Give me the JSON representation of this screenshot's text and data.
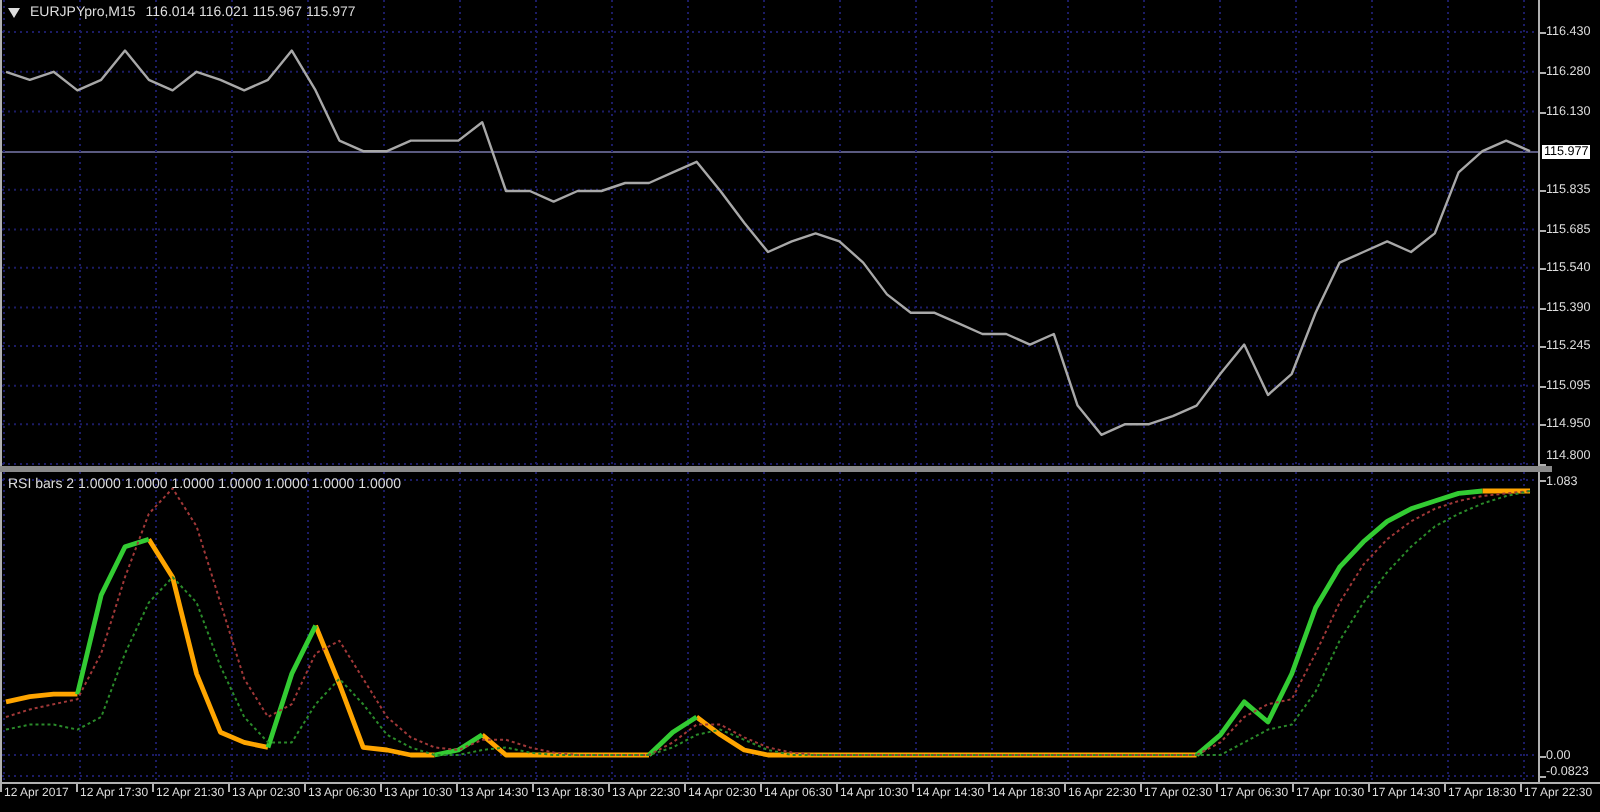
{
  "main_pane": {
    "title": "EURJPYpro,M15",
    "quote": "116.014 116.021 115.967 115.977",
    "chart_data": {
      "type": "line",
      "grid": true,
      "ylim": [
        114.792,
        116.551
      ],
      "ref_lines": [
        {
          "axis": "y",
          "value": 115.977,
          "label": "115.977"
        }
      ],
      "yticks": [
        {
          "value": 116.43,
          "label": "116.430"
        },
        {
          "value": 116.28,
          "label": "116.280"
        },
        {
          "value": 116.13,
          "label": "116.130"
        },
        {
          "value": 115.835,
          "label": "115.835"
        },
        {
          "value": 115.685,
          "label": "115.685"
        },
        {
          "value": 115.54,
          "label": "115.540"
        },
        {
          "value": 115.39,
          "label": "115.390"
        },
        {
          "value": 115.245,
          "label": "115.245"
        },
        {
          "value": 115.095,
          "label": "115.095"
        },
        {
          "value": 114.95,
          "label": "114.950"
        },
        {
          "value": 114.8,
          "label": "114.800"
        }
      ],
      "series": [
        {
          "color": "#a8a8a8",
          "values": [
            116.28,
            116.25,
            116.28,
            116.21,
            116.25,
            116.36,
            116.25,
            116.21,
            116.28,
            116.25,
            116.21,
            116.25,
            116.36,
            116.21,
            116.02,
            115.98,
            115.98,
            116.02,
            116.02,
            116.02,
            116.09,
            115.83,
            115.83,
            115.79,
            115.83,
            115.83,
            115.86,
            115.86,
            115.9,
            115.94,
            115.83,
            115.71,
            115.6,
            115.64,
            115.67,
            115.64,
            115.56,
            115.44,
            115.37,
            115.37,
            115.33,
            115.29,
            115.29,
            115.25,
            115.29,
            115.02,
            114.91,
            114.95,
            114.95,
            114.98,
            115.02,
            115.14,
            115.25,
            115.06,
            115.14,
            115.37,
            115.56,
            115.6,
            115.64,
            115.6,
            115.67,
            115.9,
            115.98,
            116.02,
            115.98
          ]
        }
      ]
    }
  },
  "indicator_pane": {
    "title": "RSI bars 2 1.0000 1.0000 1.0000 1.0000 1.0000 1.0000 1.0000",
    "chart_data": {
      "type": "line",
      "grid": true,
      "ylim": [
        -0.0823,
        1.083
      ],
      "yticks": [
        {
          "value": 1.083,
          "label": "1.083"
        },
        {
          "value": 0,
          "label": "0.00"
        },
        {
          "value": -0.0823,
          "label": "-0.0823"
        }
      ],
      "series": [
        {
          "color": "#ffa500",
          "line_style": "solid",
          "values": [
            0.21,
            0.23,
            0.24,
            0.24,
            null,
            null,
            0.85,
            0.7,
            0.32,
            0.09,
            0.05,
            0.03,
            null,
            0.51,
            0.28,
            0.03,
            0.02,
            0,
            0,
            null,
            0.08,
            0,
            0,
            0,
            0,
            0,
            0,
            0,
            null,
            0.15,
            0.08,
            0.02,
            0,
            0,
            0,
            0,
            0,
            0,
            0,
            0,
            0,
            0,
            0,
            0,
            0,
            0,
            0,
            0,
            0,
            0,
            0,
            null,
            null,
            null,
            null,
            null,
            null,
            null,
            null,
            null,
            null,
            null,
            1.04,
            1.04,
            1.04
          ]
        },
        {
          "color": "#33cc33",
          "line_style": "solid",
          "values": [
            null,
            null,
            null,
            0.24,
            0.63,
            0.82,
            0.85,
            null,
            null,
            null,
            null,
            0.03,
            0.32,
            0.51,
            null,
            null,
            null,
            null,
            0,
            0.02,
            0.08,
            null,
            null,
            null,
            null,
            null,
            null,
            0,
            0.09,
            0.15,
            null,
            null,
            null,
            null,
            null,
            null,
            null,
            null,
            null,
            null,
            null,
            null,
            null,
            null,
            null,
            null,
            null,
            null,
            null,
            null,
            0,
            0.08,
            0.21,
            0.13,
            0.32,
            0.58,
            0.74,
            0.84,
            0.92,
            0.97,
            1.0,
            1.03,
            1.04,
            null,
            null
          ]
        },
        {
          "color": "#a03838",
          "line_style": "dotted",
          "values": [
            0.15,
            0.18,
            0.2,
            0.22,
            0.4,
            0.7,
            0.95,
            1.05,
            0.9,
            0.6,
            0.3,
            0.15,
            0.2,
            0.4,
            0.45,
            0.3,
            0.15,
            0.07,
            0.03,
            0.02,
            0.06,
            0.06,
            0.03,
            0.01,
            0,
            0,
            0,
            0,
            0.05,
            0.12,
            0.12,
            0.07,
            0.03,
            0.01,
            0,
            0,
            0,
            0,
            0,
            0,
            0,
            0,
            0,
            0,
            0,
            0,
            0,
            0,
            0,
            0,
            0,
            0.05,
            0.15,
            0.2,
            0.22,
            0.4,
            0.6,
            0.75,
            0.85,
            0.92,
            0.97,
            1.0,
            1.02,
            1.03,
            1.04
          ]
        },
        {
          "color": "#2a8a2a",
          "line_style": "dotted",
          "values": [
            0.1,
            0.12,
            0.12,
            0.1,
            0.15,
            0.4,
            0.6,
            0.7,
            0.6,
            0.35,
            0.15,
            0.05,
            0.05,
            0.2,
            0.3,
            0.2,
            0.08,
            0.03,
            0,
            0,
            0.02,
            0.03,
            0.01,
            0,
            0,
            0,
            0,
            0,
            0.03,
            0.08,
            0.1,
            0.06,
            0.02,
            0,
            0,
            0,
            0,
            0,
            0,
            0,
            0,
            0,
            0,
            0,
            0,
            0,
            0,
            0,
            0,
            0,
            0,
            0,
            0.05,
            0.1,
            0.12,
            0.25,
            0.45,
            0.6,
            0.72,
            0.82,
            0.9,
            0.95,
            0.99,
            1.02,
            1.04
          ]
        }
      ]
    }
  },
  "time_axis": {
    "labels": [
      "12 Apr 2017",
      "12 Apr 17:30",
      "12 Apr 21:30",
      "13 Apr 02:30",
      "13 Apr 06:30",
      "13 Apr 10:30",
      "13 Apr 14:30",
      "13 Apr 18:30",
      "13 Apr 22:30",
      "14 Apr 02:30",
      "14 Apr 06:30",
      "14 Apr 10:30",
      "14 Apr 14:30",
      "14 Apr 18:30",
      "16 Apr 22:30",
      "17 Apr 02:30",
      "17 Apr 06:30",
      "17 Apr 10:30",
      "17 Apr 14:30",
      "17 Apr 18:30",
      "17 Apr 22:30"
    ]
  }
}
